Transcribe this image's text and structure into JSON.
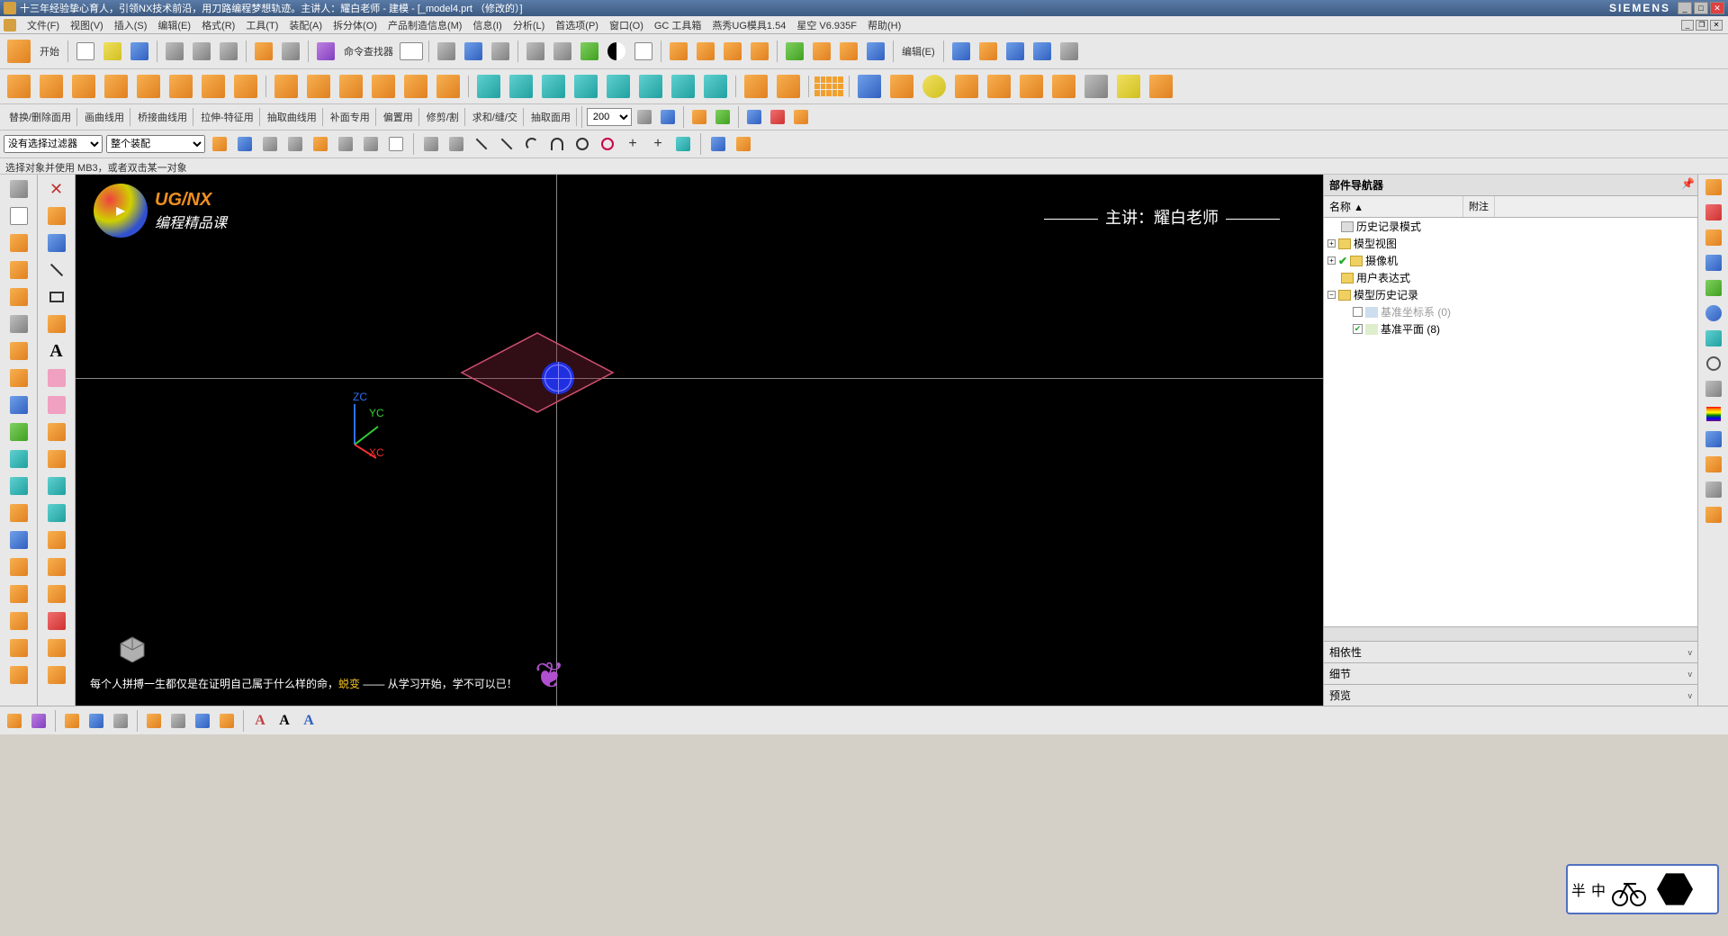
{
  "title_bar": {
    "title": "十三年经验挚心育人，引领NX技术前沿，用刀路编程梦想轨迹。主讲人：耀白老师 - 建模 - [_model4.prt （修改的）]",
    "brand": "SIEMENS"
  },
  "menu": {
    "items": [
      "文件(F)",
      "视图(V)",
      "插入(S)",
      "编辑(E)",
      "格式(R)",
      "工具(T)",
      "装配(A)",
      "拆分体(O)",
      "产品制造信息(M)",
      "信息(I)",
      "分析(L)",
      "首选项(P)",
      "窗口(O)",
      "GC 工具箱",
      "燕秀UG模具1.54",
      "星空 V6.935F",
      "帮助(H)"
    ]
  },
  "toolbar1": {
    "start_label": "开始",
    "cmd_finder": "命令查找器",
    "edit_label": "编辑(E)"
  },
  "toolbar3": {
    "items": [
      "替换/删除面用",
      "画曲线用",
      "桥接曲线用",
      "拉伸-特征用",
      "抽取曲线用",
      "补面专用",
      "偏置用",
      "修剪/割",
      "求和/缝/交",
      "抽取面用"
    ],
    "num_value": "200"
  },
  "filter_row": {
    "sel1": "没有选择过滤器",
    "sel2": "整个装配"
  },
  "tip_bar": "选择对象并使用 MB3，或者双击某一对象",
  "viewport": {
    "logo_line1": "UG/NX",
    "logo_line2": "编程精品课",
    "lecturer": "主讲：耀白老师",
    "triad": {
      "x": "XC",
      "y": "YC",
      "z": "ZC"
    },
    "caption_pre": "每个人拼搏一生都仅是在证明自己属于什么样的命，",
    "caption_hl": "蜕变",
    "caption_post": " —— 从学习开始，学不可以已！"
  },
  "nav": {
    "title": "部件导航器",
    "col_name": "名称",
    "col_note": "附注",
    "rows": {
      "history_mode": "历史记录模式",
      "model_view": "模型视图",
      "camera": "摄像机",
      "user_expr": "用户表达式",
      "model_history": "模型历史记录",
      "datum_csys": "基准坐标系 (0)",
      "datum_plane": "基准平面 (8)"
    },
    "sections": {
      "dep": "相依性",
      "detail": "细节",
      "preview": "预览"
    }
  },
  "overlay": {
    "t1": "半",
    "t2": "中"
  }
}
